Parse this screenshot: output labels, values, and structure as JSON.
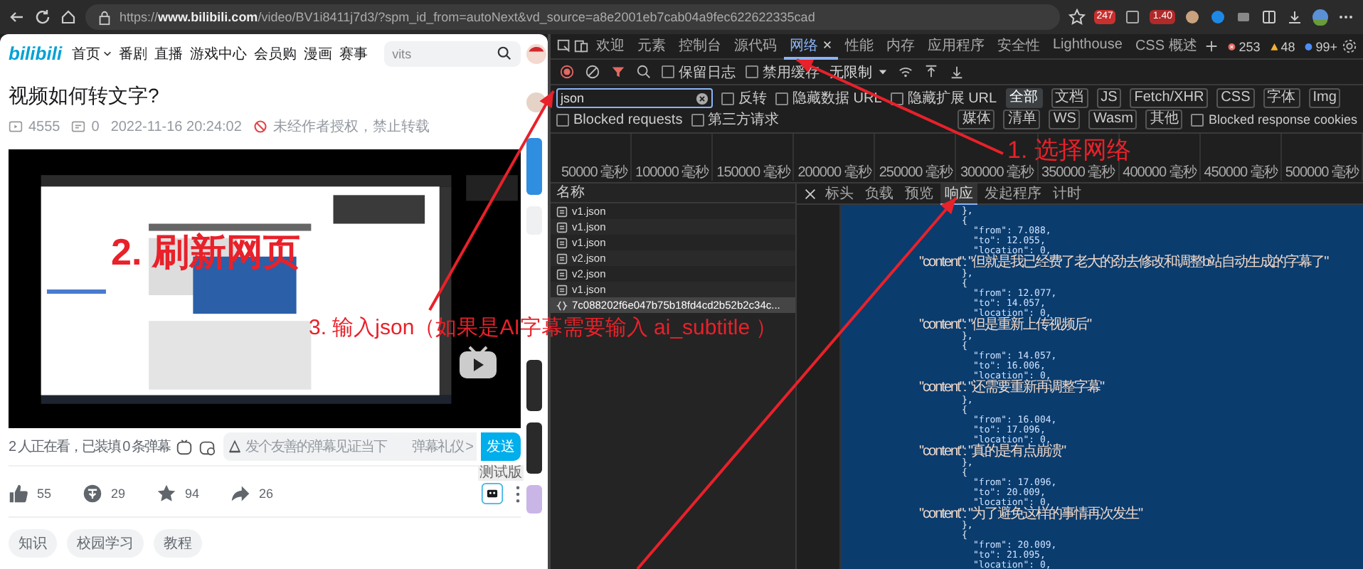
{
  "browser": {
    "url": "https://**www.bilibili.com**/video/BV1i8411j7d3/?spm_id_from=autoNext&vd_source=a8e2001eb7cab04a9fec622622335cad",
    "badges": [
      "247",
      "1.40"
    ]
  },
  "site": {
    "logo": "bilibili",
    "search": "vits",
    "nav": [
      {
        "label": "首页",
        "kind": "dropdown"
      },
      {
        "label": "番剧",
        "kind": "link"
      },
      {
        "label": "直播",
        "kind": "link"
      },
      {
        "label": "游戏中心",
        "kind": "link"
      },
      {
        "label": "会员购",
        "kind": "link"
      },
      {
        "label": "漫画",
        "kind": "link"
      },
      {
        "label": "赛事",
        "kind": "link"
      }
    ]
  },
  "video": {
    "title": "视频如何转文字?",
    "views": "4555",
    "danmaku": "0",
    "date": "2022-11-16 20:24:02",
    "notice": "未经作者授权，禁止转载"
  },
  "danmaku_bar": {
    "watching": "2 人正在看，已装填 0 条弹幕",
    "placeholder": "发个友善的弹幕见证当下",
    "etiquette": "弹幕礼仪 >",
    "send": "发送"
  },
  "actions": [
    {
      "kind": "like",
      "count": "55"
    },
    {
      "kind": "coin",
      "count": "29"
    },
    {
      "kind": "favorite",
      "count": "94"
    },
    {
      "kind": "share",
      "count": "26"
    }
  ],
  "beta_tooltip": "测试版",
  "tags": [
    "知识",
    "校园学习",
    "教程"
  ],
  "devtools": {
    "tabs": [
      {
        "label": "欢迎",
        "selected": false
      },
      {
        "label": "元素",
        "selected": false
      },
      {
        "label": "控制台",
        "selected": false
      },
      {
        "label": "源代码",
        "selected": false
      },
      {
        "label": "网络",
        "selected": true
      },
      {
        "label": "性能",
        "selected": false
      },
      {
        "label": "内存",
        "selected": false
      },
      {
        "label": "应用程序",
        "selected": false
      },
      {
        "label": "安全性",
        "selected": false
      },
      {
        "label": "Lighthouse",
        "selected": false
      },
      {
        "label": "CSS 概述",
        "selected": false
      }
    ],
    "counts": {
      "errors": "253",
      "warnings": "48",
      "info": "99+"
    },
    "preserve_log": {
      "label": "保留日志",
      "checked": false
    },
    "disable_cache": {
      "label": "禁用缓存",
      "checked": false
    },
    "throttle": "无限制",
    "filter": "json",
    "options": [
      {
        "label": "反转",
        "checked": false
      },
      {
        "label": "隐藏数据 URL",
        "checked": false
      },
      {
        "label": "隐藏扩展 URL",
        "checked": false
      }
    ],
    "types": [
      {
        "label": "全部",
        "selected": true
      },
      {
        "label": "文档",
        "selected": false
      },
      {
        "label": "JS",
        "selected": false
      },
      {
        "label": "Fetch/XHR",
        "selected": false
      },
      {
        "label": "CSS",
        "selected": false
      },
      {
        "label": "字体",
        "selected": false
      },
      {
        "label": "Img",
        "selected": false
      },
      {
        "label": "媒体",
        "selected": false
      },
      {
        "label": "清单",
        "selected": false
      },
      {
        "label": "WS",
        "selected": false
      },
      {
        "label": "Wasm",
        "selected": false
      },
      {
        "label": "其他",
        "selected": false
      }
    ],
    "response_cookies": {
      "label": "Blocked response cookies",
      "checked": false
    },
    "extra_options": [
      {
        "label": "Blocked requests",
        "checked": false
      },
      {
        "label": "第三方请求",
        "checked": false
      }
    ],
    "timeline_ticks": [
      "50000 毫秒",
      "100000 毫秒",
      "150000 毫秒",
      "200000 毫秒",
      "250000 毫秒",
      "300000 毫秒",
      "350000 毫秒",
      "400000 毫秒",
      "450000 毫秒",
      "500000 毫秒"
    ],
    "list_header": "名称",
    "requests": [
      {
        "name": "v1.json",
        "kind": "file",
        "selected": false
      },
      {
        "name": "v1.json",
        "kind": "file",
        "selected": false
      },
      {
        "name": "v1.json",
        "kind": "file",
        "selected": false
      },
      {
        "name": "v2.json",
        "kind": "file",
        "selected": false
      },
      {
        "name": "v2.json",
        "kind": "file",
        "selected": false
      },
      {
        "name": "v1.json",
        "kind": "file",
        "selected": false
      },
      {
        "name": "7c088202f6e047b75b18fd4cd2b52b2c34c...",
        "kind": "json",
        "selected": true
      }
    ],
    "detail_tabs": [
      {
        "label": "标头",
        "selected": false
      },
      {
        "label": "负载",
        "selected": false
      },
      {
        "label": "预览",
        "selected": false
      },
      {
        "label": "响应",
        "selected": true
      },
      {
        "label": "发起程序",
        "selected": false
      },
      {
        "label": "计时",
        "selected": false
      }
    ],
    "response_lines": [
      {
        "kind": "brace",
        "text": "},"
      },
      {
        "kind": "brace",
        "text": "{"
      },
      {
        "kind": "field",
        "text": "\"from\": 7.088,"
      },
      {
        "kind": "field",
        "text": "\"to\": 12.055,"
      },
      {
        "kind": "field",
        "text": "\"location\": 0,"
      },
      {
        "kind": "content",
        "text": "\"content\": \"但就是我已经费了老大的劲去修改和调整b站自动生成的字幕了\""
      },
      {
        "kind": "brace",
        "text": "},"
      },
      {
        "kind": "brace",
        "text": "{"
      },
      {
        "kind": "field",
        "text": "\"from\": 12.077,"
      },
      {
        "kind": "field",
        "text": "\"to\": 14.057,"
      },
      {
        "kind": "field",
        "text": "\"location\": 0,"
      },
      {
        "kind": "content",
        "text": "\"content\": \"但是重新上传视频后\""
      },
      {
        "kind": "brace",
        "text": "},"
      },
      {
        "kind": "brace",
        "text": "{"
      },
      {
        "kind": "field",
        "text": "\"from\": 14.057,"
      },
      {
        "kind": "field",
        "text": "\"to\": 16.006,"
      },
      {
        "kind": "field",
        "text": "\"location\": 0,"
      },
      {
        "kind": "content",
        "text": "\"content\": \"还需要重新再调整字幕\""
      },
      {
        "kind": "brace",
        "text": "},"
      },
      {
        "kind": "brace",
        "text": "{"
      },
      {
        "kind": "field",
        "text": "\"from\": 16.004,"
      },
      {
        "kind": "field",
        "text": "\"to\": 17.096,"
      },
      {
        "kind": "field",
        "text": "\"location\": 0,"
      },
      {
        "kind": "content",
        "text": "\"content\": \"真的是有点崩溃\""
      },
      {
        "kind": "brace",
        "text": "},"
      },
      {
        "kind": "brace",
        "text": "{"
      },
      {
        "kind": "field",
        "text": "\"from\": 17.096,"
      },
      {
        "kind": "field",
        "text": "\"to\": 20.009,"
      },
      {
        "kind": "field",
        "text": "\"location\": 0,"
      },
      {
        "kind": "content",
        "text": "\"content\": \"为了避免这样的事情再次发生\""
      },
      {
        "kind": "brace",
        "text": "},"
      },
      {
        "kind": "brace",
        "text": "{"
      },
      {
        "kind": "field",
        "text": "\"from\": 20.009,"
      },
      {
        "kind": "field",
        "text": "\"to\": 21.095,"
      },
      {
        "kind": "field",
        "text": "\"location\": 0,"
      }
    ]
  },
  "annotations": [
    "1. 选择网络",
    "2. 刷新网页",
    "3. 输入json（如果是AI字幕需要输入 ai_subtitle ）"
  ]
}
